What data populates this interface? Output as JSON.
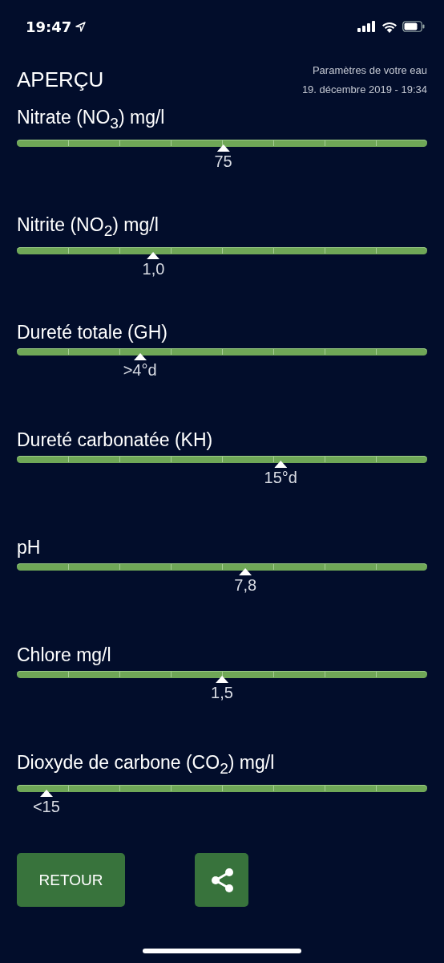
{
  "status_bar": {
    "time": "19:47"
  },
  "header": {
    "title": "APERÇU",
    "subtitle": "Paramètres de votre eau",
    "date": "19. décembre 2019 - 19:34"
  },
  "parameters": [
    {
      "name": "Nitrate (NO$_{3}$) mg/l",
      "level": 0.503,
      "reading": "75"
    },
    {
      "name": "Nitrite (NO$_{2}$) mg/l",
      "level": 0.333,
      "reading": "1,0"
    },
    {
      "name": "Dureté totale (GH)",
      "level": 0.3,
      "reading": ">4°d"
    },
    {
      "name": "Dureté carbonatée (KH)",
      "level": 0.643,
      "reading": "15°d"
    },
    {
      "name": "pH",
      "level": 0.557,
      "reading": "7,8"
    },
    {
      "name": "Chlore mg/l",
      "level": 0.5,
      "reading": "1,5"
    },
    {
      "name": "Dioxyde de carbone (CO$_{2}$) mg/l",
      "level": 0.072,
      "reading": "<15"
    }
  ],
  "buttons": {
    "back": "RETOUR"
  }
}
